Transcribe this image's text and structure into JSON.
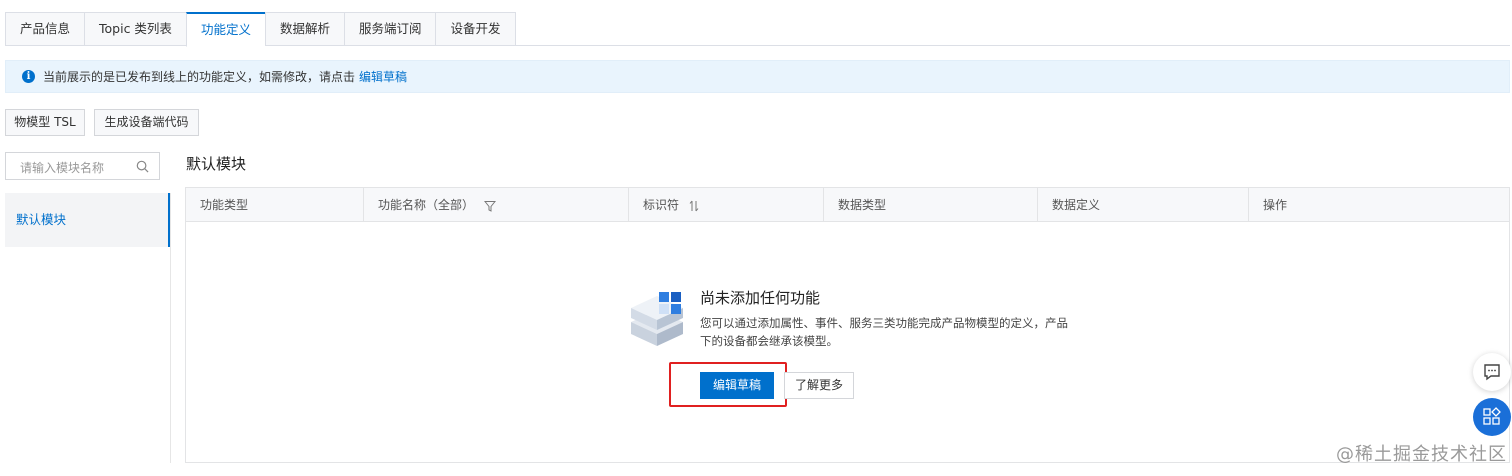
{
  "tabs": [
    {
      "label": "产品信息"
    },
    {
      "label": "Topic 类列表"
    },
    {
      "label": "功能定义"
    },
    {
      "label": "数据解析"
    },
    {
      "label": "服务端订阅"
    },
    {
      "label": "设备开发"
    }
  ],
  "banner": {
    "text": "当前展示的是已发布到线上的功能定义，如需修改，请点击",
    "link": "编辑草稿"
  },
  "toolbar": {
    "tsl_label": "物模型 TSL",
    "gen_code_label": "生成设备端代码"
  },
  "sidebar": {
    "search_placeholder": "请输入模块名称",
    "items": [
      {
        "label": "默认模块"
      }
    ]
  },
  "main": {
    "module_title": "默认模块",
    "columns": [
      "功能类型",
      "功能名称（全部）",
      "标识符",
      "数据类型",
      "数据定义",
      "操作"
    ]
  },
  "empty": {
    "title": "尚未添加任何功能",
    "desc": "您可以通过添加属性、事件、服务三类功能完成产品物模型的定义，产品下的设备都会继承该模型。",
    "primary": "编辑草稿",
    "secondary": "了解更多"
  },
  "watermark": "@稀土掘金技术社区",
  "colors": {
    "accent": "#0070cc",
    "highlight_border": "#e02020",
    "banner_bg": "#e9f4fd"
  }
}
